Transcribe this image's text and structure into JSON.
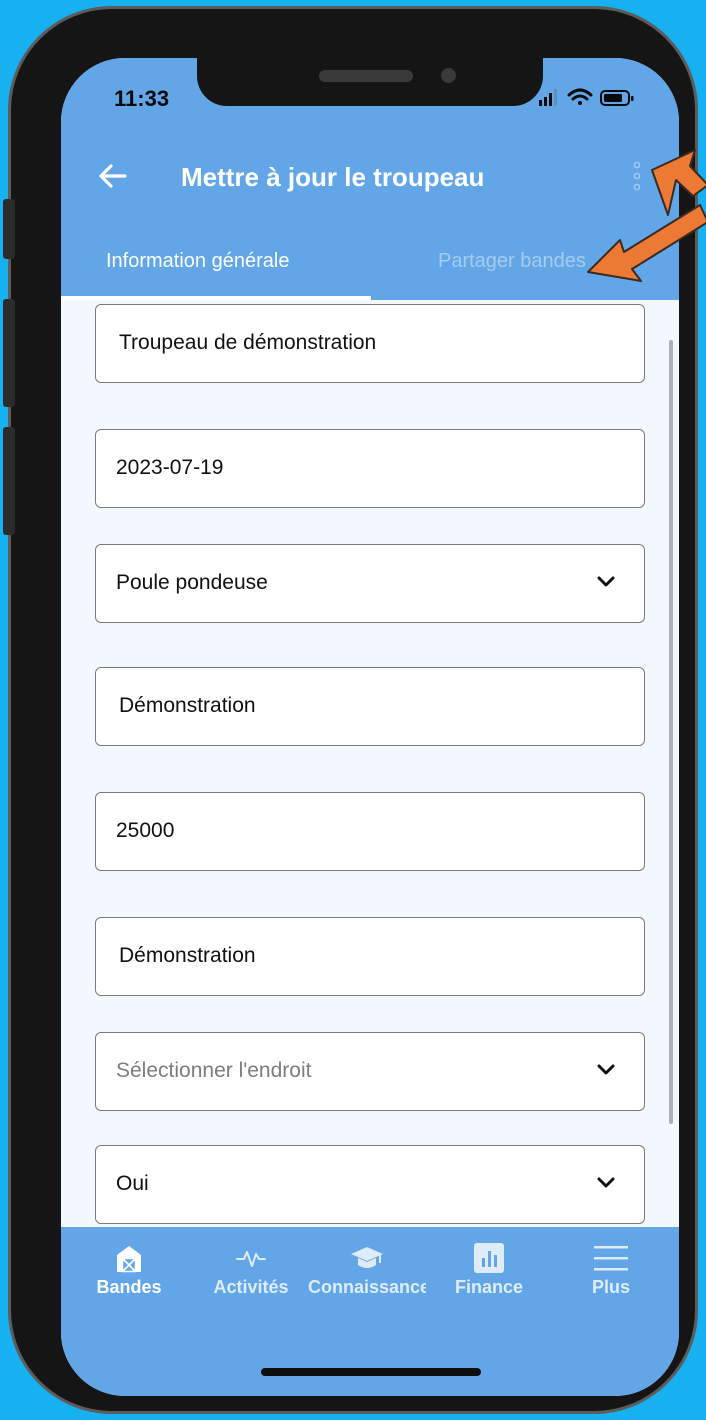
{
  "status_bar": {
    "time": "11:33"
  },
  "header": {
    "title": "Mettre à jour le troupeau",
    "tabs": [
      {
        "label": "Information générale",
        "active": true
      },
      {
        "label": "Partager bandes",
        "active": false
      }
    ]
  },
  "form": {
    "flock_name": "Troupeau de démonstration",
    "date": "2023-07-19",
    "bird_type": "Poule pondeuse",
    "field_4": "Démonstration",
    "quantity": "25000",
    "field_6": "Démonstration",
    "location_placeholder": "Sélectionner l'endroit",
    "last_select": "Oui"
  },
  "bottom_nav": {
    "items": [
      {
        "label": "Bandes",
        "icon": "barn-icon",
        "active": true
      },
      {
        "label": "Activités",
        "icon": "activity-icon",
        "active": false
      },
      {
        "label": "Connaissance",
        "icon": "graduation-cap-icon",
        "active": false
      },
      {
        "label": "Finance",
        "icon": "bar-chart-icon",
        "active": false
      },
      {
        "label": "Plus",
        "icon": "menu-icon",
        "active": false
      }
    ]
  },
  "colors": {
    "app_bar": "#62a6e8",
    "page_background": "#17b0f0",
    "annotation_arrow": "#ec7a35",
    "screen_background": "#f2f8fd"
  }
}
